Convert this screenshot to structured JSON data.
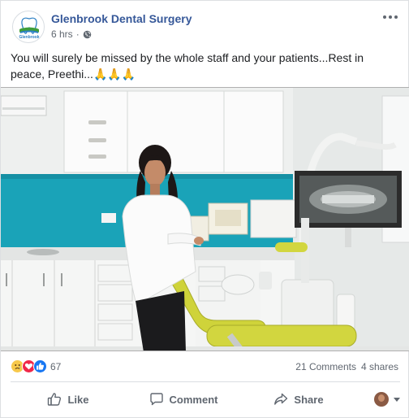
{
  "page": {
    "name": "Glenbrook Dental Surgery",
    "logo_text": "Glenbrook",
    "time": "6 hrs",
    "separator": "·",
    "audience_icon": "globe-icon"
  },
  "post": {
    "text": "You will surely be missed by the whole staff and your patients...Rest in peace, Preethi...",
    "emoji": "🙏🙏🙏"
  },
  "photo": {
    "icon": "dental-clinic-photo"
  },
  "stats": {
    "reactions": [
      "sad-reaction-icon",
      "love-reaction-icon",
      "like-reaction-icon"
    ],
    "reaction_count": "67",
    "comments": "21 Comments",
    "shares": "4 shares"
  },
  "actions": {
    "like": "Like",
    "comment": "Comment",
    "share": "Share"
  },
  "colors": {
    "page_name": "#365899",
    "secondary_text": "#606770",
    "like_blue": "#1877f2",
    "love_red": "#f02849",
    "sad_yellow": "#f7c84a",
    "wall_teal": "#1aa3b8",
    "chair_yellow": "#cfd33a"
  }
}
